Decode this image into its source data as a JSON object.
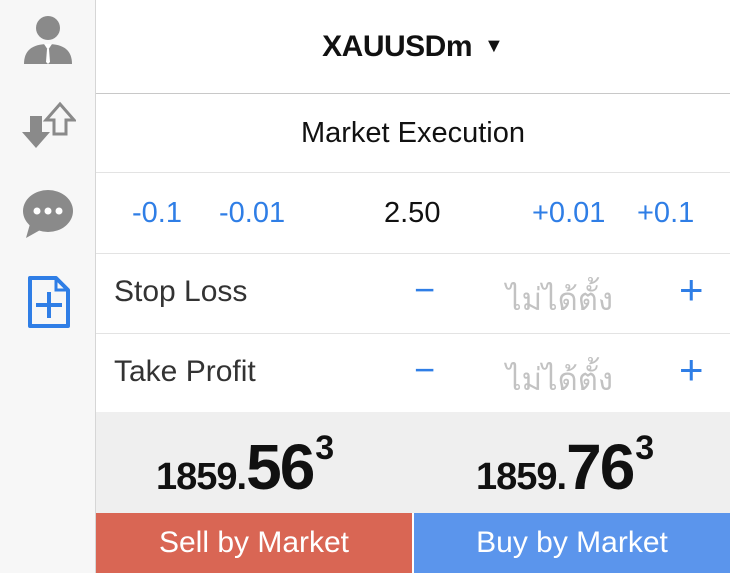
{
  "sidebar": {
    "items": [
      {
        "icon": "user-icon"
      },
      {
        "icon": "transfer-icon"
      },
      {
        "icon": "chat-icon"
      },
      {
        "icon": "new-order-icon",
        "active": true
      }
    ],
    "colors": {
      "icon_gray": "#8a8a8a",
      "active_blue": "#2f7ee6"
    }
  },
  "header": {
    "symbol": "XAUUSDm",
    "caret": "▼"
  },
  "execution": {
    "label": "Market Execution"
  },
  "volume": {
    "dec_large": "-0.1",
    "dec_small": "-0.01",
    "value": "2.50",
    "inc_small": "+0.01",
    "inc_large": "+0.1"
  },
  "stop_loss": {
    "label": "Stop Loss",
    "minus": "−",
    "placeholder": "ไม่ได้ตั้ง",
    "plus": "+"
  },
  "take_profit": {
    "label": "Take Profit",
    "minus": "−",
    "placeholder": "ไม่ได้ตั้ง",
    "plus": "+"
  },
  "prices": {
    "sell": {
      "prefix": "1859.",
      "big": "56",
      "sup": "3"
    },
    "buy": {
      "prefix": "1859.",
      "big": "76",
      "sup": "3"
    }
  },
  "actions": {
    "sell_label": "Sell by Market",
    "buy_label": "Buy by Market",
    "sell_color": "#d96654",
    "buy_color": "#5b95ec"
  }
}
